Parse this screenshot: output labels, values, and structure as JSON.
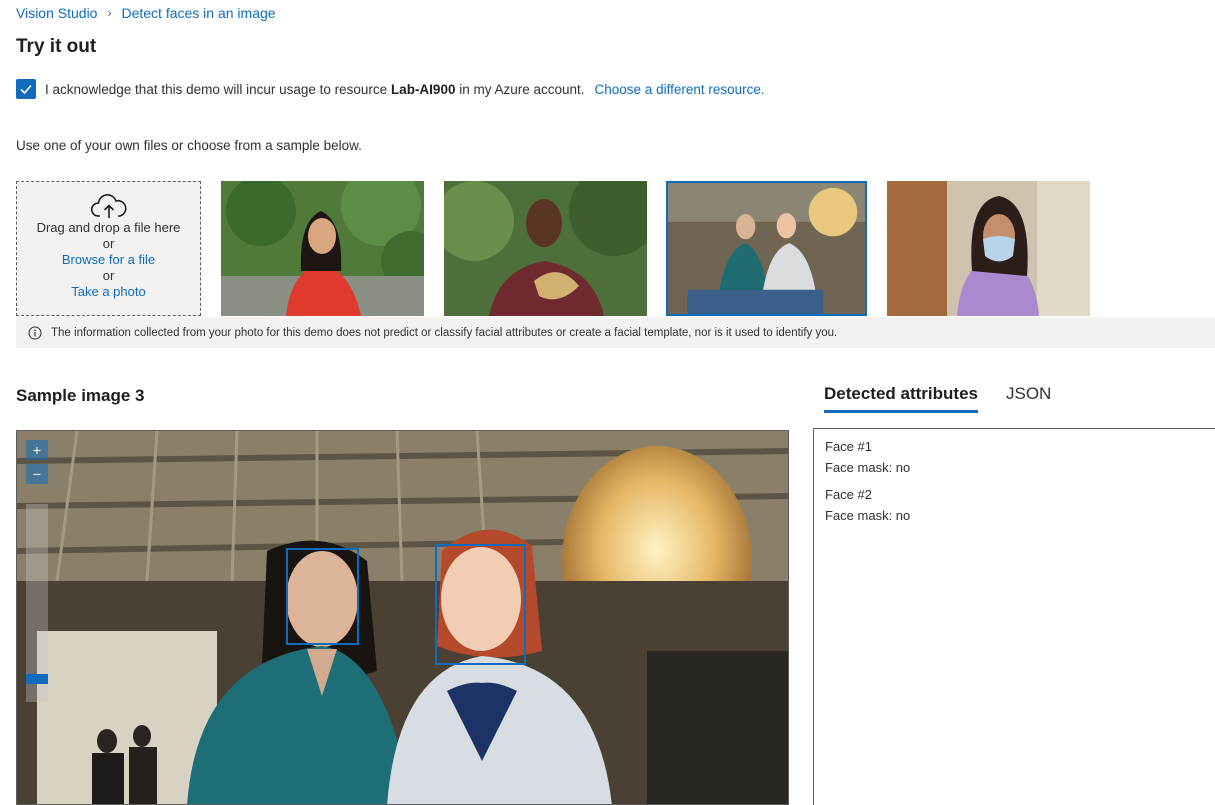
{
  "breadcrumb": {
    "root": "Vision Studio",
    "current": "Detect faces in an image"
  },
  "page_title": "Try it out",
  "acknowledge": {
    "checked": true,
    "text_before": "I acknowledge that this demo will incur usage to resource ",
    "resource": "Lab-AI900",
    "text_after": " in my Azure account.",
    "link": "Choose a different resource."
  },
  "instruction": "Use one of your own files or choose from a sample below.",
  "upload": {
    "drag_text": "Drag and drop a file here",
    "or1": "or",
    "browse": "Browse for a file",
    "or2": "or",
    "photo": "Take a photo"
  },
  "info_text": "The information collected from your photo for this demo does not predict or classify facial attributes or create a facial template, nor is it used to identify you.",
  "sample_title": "Sample image 3",
  "tabs": [
    {
      "label": "Detected attributes",
      "active": true
    },
    {
      "label": "JSON",
      "active": false
    }
  ],
  "zoom": {
    "in": "+",
    "out": "−"
  },
  "faces": [
    {
      "name": "Face #1",
      "mask": "Face mask: no"
    },
    {
      "name": "Face #2",
      "mask": "Face mask: no"
    }
  ],
  "colors": {
    "accent": "#0f6cbd",
    "info_bg": "#f3f2f1"
  }
}
